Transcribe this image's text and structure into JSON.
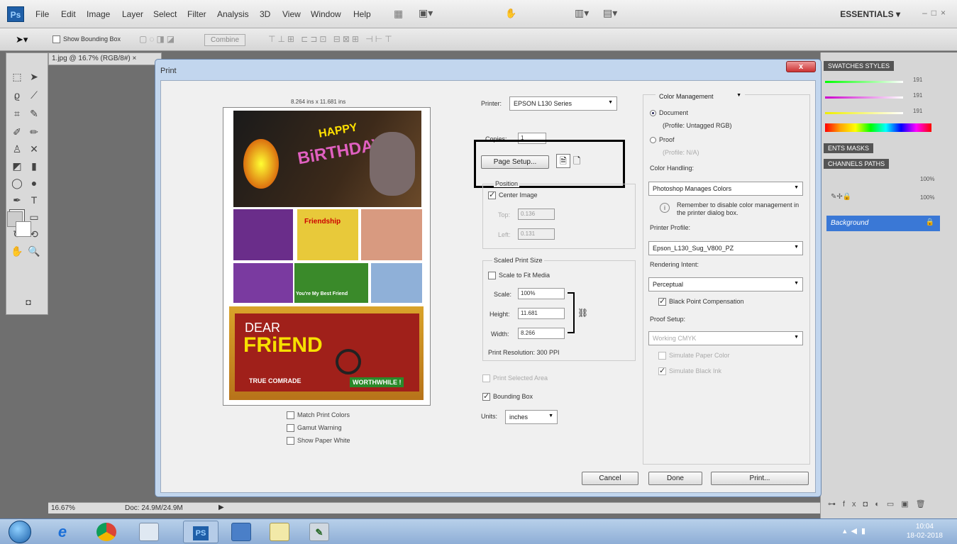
{
  "app": {
    "logo": "Ps",
    "menu": [
      "File",
      "Edit",
      "Image",
      "Layer",
      "Select",
      "Filter",
      "Analysis",
      "3D",
      "View",
      "Window",
      "Help"
    ],
    "workspace_label": "ESSENTIALS ▾",
    "options_bar": {
      "show_bounding_box": "Show Bounding Box",
      "combine": "Combine"
    },
    "doc_tab": "1.jpg @ 16.7% (RGB/8#) ×",
    "status": {
      "zoom": "16.67%",
      "doc": "Doc: 24.9M/24.9M"
    },
    "panels": {
      "swatches_tab": "SWATCHES STYLES",
      "adjust_tab": "ENTS MASKS",
      "layers_tab": "CHANNELS PATHS",
      "opacity": "100%",
      "fill": "100%",
      "slider_values": [
        "191",
        "191",
        "191"
      ],
      "layer_name": "Background"
    }
  },
  "taskbar": {
    "time": "10:04",
    "date": "18-02-2018",
    "apps": [
      "e",
      "PS"
    ]
  },
  "dialog": {
    "title": "Print",
    "close": "x",
    "preview_size": "8.264 ins x 11.681 ins",
    "preview_text": {
      "happy": "HAPPY",
      "birthday": "BiRTHDAY",
      "friendship": "Friendship",
      "best_friend": "You're My Best Friend",
      "dear": "DEAR",
      "friend": "FRiEND",
      "comrade": "TRUE COMRADE",
      "worthwhile": "WORTHWHILE !"
    },
    "below_preview": {
      "match": "Match Print Colors",
      "gamut": "Gamut Warning",
      "paper": "Show Paper White"
    },
    "printer_label": "Printer:",
    "printer_value": "EPSON L130 Series",
    "copies_label": "Copies:",
    "copies_value": "1",
    "page_setup": "Page Setup...",
    "position": {
      "label": "Position",
      "center": "Center Image",
      "top_label": "Top:",
      "top_value": "0.136",
      "left_label": "Left:",
      "left_value": "0.131"
    },
    "scaled": {
      "label": "Scaled Print Size",
      "fit": "Scale to Fit Media",
      "scale_label": "Scale:",
      "scale_value": "100%",
      "height_label": "Height:",
      "height_value": "11.681",
      "width_label": "Width:",
      "width_value": "8.266",
      "resolution": "Print Resolution: 300 PPI"
    },
    "print_selected": "Print Selected Area",
    "bounding_box": "Bounding Box",
    "units_label": "Units:",
    "units_value": "inches",
    "color_mgmt": {
      "header": "Color Management",
      "document": "Document",
      "document_profile": "(Profile: Untagged RGB)",
      "proof": "Proof",
      "proof_profile": "(Profile: N/A)",
      "handling_label": "Color Handling:",
      "handling_value": "Photoshop Manages Colors",
      "remember": "Remember to disable color management in the printer dialog box.",
      "profile_label": "Printer Profile:",
      "profile_value": "Epson_L130_Sug_V800_PZ",
      "intent_label": "Rendering Intent:",
      "intent_value": "Perceptual",
      "bpc": "Black Point Compensation",
      "proof_setup_label": "Proof Setup:",
      "proof_setup_value": "Working CMYK",
      "sim_paper": "Simulate Paper Color",
      "sim_ink": "Simulate Black Ink"
    },
    "buttons": {
      "cancel": "Cancel",
      "done": "Done",
      "print": "Print..."
    }
  }
}
